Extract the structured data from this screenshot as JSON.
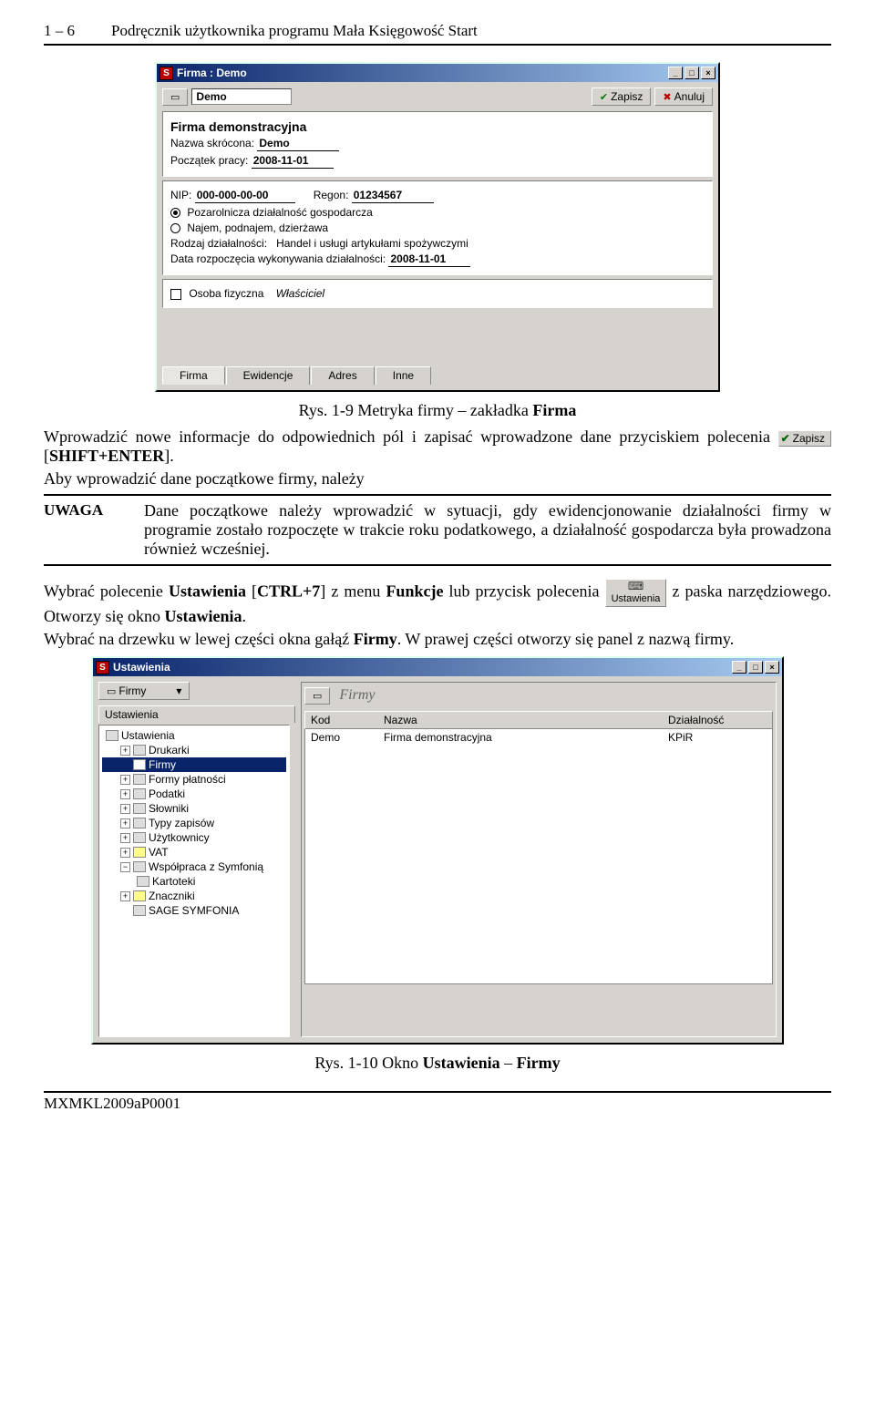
{
  "header": {
    "page": "1 – 6",
    "title": "Podręcznik użytkownika programu Mała Księgowość Start"
  },
  "caption1": {
    "prefix": "Rys. 1-9 Metryka firmy – zakładka ",
    "bold": "Firma"
  },
  "para1": {
    "a": "Wprowadzić nowe informacje do odpowiednich pól i zapisać wprowadzone dane przyciskiem polecenia ",
    "btnLabel": "Zapisz",
    "b": " [",
    "key": "SHIFT+ENTER",
    "c": "]."
  },
  "para2": "Aby wprowadzić dane początkowe firmy, należy",
  "uwaga": {
    "label": "UWAGA",
    "text": "Dane początkowe należy wprowadzić w sytuacji, gdy ewidencjonowanie działalności firmy w programie zostało rozpoczęte w trakcie roku podatkowego, a działalność gospodarcza była prowadzona również wcześniej."
  },
  "para3": {
    "a": "Wybrać polecenie ",
    "b": "Ustawienia",
    "c": " [",
    "key": "CTRL+7",
    "d": "] z menu ",
    "e": "Funkcje",
    "f": " lub przycisk polecenia ",
    "iconLabel": "Ustawienia",
    "g": " z paska narzędziowego. Otworzy się okno ",
    "h": "Ustawienia",
    "i": "."
  },
  "para4": {
    "a": "Wybrać na drzewku w lewej części okna gałąź ",
    "b": "Firmy",
    "c": ". W prawej części otworzy się panel z nazwą firmy."
  },
  "caption2": {
    "prefix": "Rys. 1-10 Okno ",
    "b1": "Ustawienia",
    "mid": " – ",
    "b2": "Firmy"
  },
  "footer": {
    "code": "MXMKL2009aP0001"
  },
  "win1": {
    "title": "Firma : Demo",
    "dropdown": "Demo",
    "btnSave": "Zapisz",
    "btnCancel": "Anuluj",
    "firmName": "Firma demonstracyjna",
    "shortNameLabel": "Nazwa skrócona:",
    "shortName": "Demo",
    "startLabel": "Początek pracy:",
    "startDate": "2008-11-01",
    "nipLabel": "NIP:",
    "nip": "000-000-00-00",
    "regonLabel": "Regon:",
    "regon": "01234567",
    "radio1": "Pozarolnicza działalność gospodarcza",
    "radio2": "Najem, podnajem, dzierżawa",
    "rodzajLabel": "Rodzaj działalności:",
    "rodzaj": "Handel i usługi artykułami spożywczymi",
    "dataRozpLabel": "Data rozpoczęcia wykonywania działalności:",
    "dataRozp": "2008-11-01",
    "osobaF": "Osoba fizyczna",
    "wlasciciel": "Właściciel",
    "tabs": [
      "Firma",
      "Ewidencje",
      "Adres",
      "Inne"
    ]
  },
  "win2": {
    "title": "Ustawienia",
    "panelHead": "Firmy",
    "treeHead": "Ustawienia",
    "tree": {
      "root": "Ustawienia",
      "items": [
        "Drukarki",
        "Firmy",
        "Formy płatności",
        "Podatki",
        "Słowniki",
        "Typy zapisów",
        "Użytkownicy",
        "VAT",
        "Współpraca z Symfonią",
        "Kartoteki",
        "Znaczniki",
        "SAGE SYMFONIA"
      ]
    },
    "grid": {
      "cols": [
        "Kod",
        "Nazwa",
        "Działalność"
      ],
      "row": {
        "kod": "Demo",
        "nazwa": "Firma demonstracyjna",
        "dz": "KPiR"
      }
    },
    "firmyLabel": "Firmy"
  }
}
